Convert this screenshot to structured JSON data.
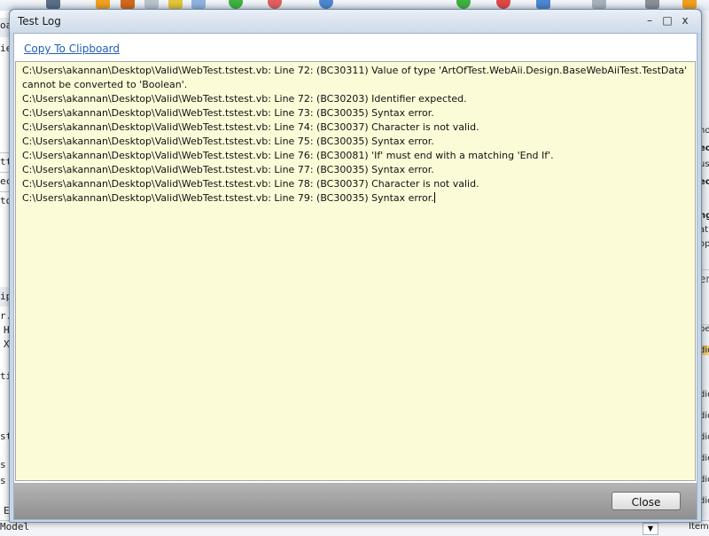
{
  "background": {
    "left_fragments": [
      "oa",
      "ie",
      "tt",
      "ec",
      "to",
      "ip",
      "r.",
      "H",
      "X",
      "ti",
      "st",
      "s",
      "s",
      "E"
    ],
    "right_fragments": [
      "nd",
      "ec",
      "us",
      "ec",
      "ng",
      "at",
      "op",
      "en",
      "pe",
      "dio",
      "dio",
      "dio",
      "dio",
      "dio",
      "dio",
      "dio"
    ],
    "bottom_label": "Model",
    "bottom_right_label": "Item"
  },
  "dialog": {
    "title": "Test Log",
    "controls": {
      "minimize": "–",
      "maximize": "□",
      "close": "x"
    },
    "copy_link": "Copy To Clipboard",
    "log_lines": [
      "C:\\Users\\akannan\\Desktop\\Valid\\WebTest.tstest.vb: Line 72: (BC30311) Value of type 'ArtOfTest.WebAii.Design.BaseWebAiiTest.TestData'",
      "cannot be converted to 'Boolean'.",
      "C:\\Users\\akannan\\Desktop\\Valid\\WebTest.tstest.vb: Line 72: (BC30203) Identifier expected.",
      "C:\\Users\\akannan\\Desktop\\Valid\\WebTest.tstest.vb: Line 73: (BC30035) Syntax error.",
      "C:\\Users\\akannan\\Desktop\\Valid\\WebTest.tstest.vb: Line 74: (BC30037) Character is not valid.",
      "C:\\Users\\akannan\\Desktop\\Valid\\WebTest.tstest.vb: Line 75: (BC30035) Syntax error.",
      "C:\\Users\\akannan\\Desktop\\Valid\\WebTest.tstest.vb: Line 76: (BC30081) 'If' must end with a matching 'End If'.",
      "C:\\Users\\akannan\\Desktop\\Valid\\WebTest.tstest.vb: Line 77: (BC30035) Syntax error.",
      "C:\\Users\\akannan\\Desktop\\Valid\\WebTest.tstest.vb: Line 78: (BC30037) Character is not valid.",
      "C:\\Users\\akannan\\Desktop\\Valid\\WebTest.tstest.vb: Line 79: (BC30035) Syntax error."
    ],
    "close_label": "Close"
  },
  "colors": {
    "log_background": "#fbfbd8",
    "link": "#1f5fb5",
    "footer": "#9f9f9f"
  }
}
